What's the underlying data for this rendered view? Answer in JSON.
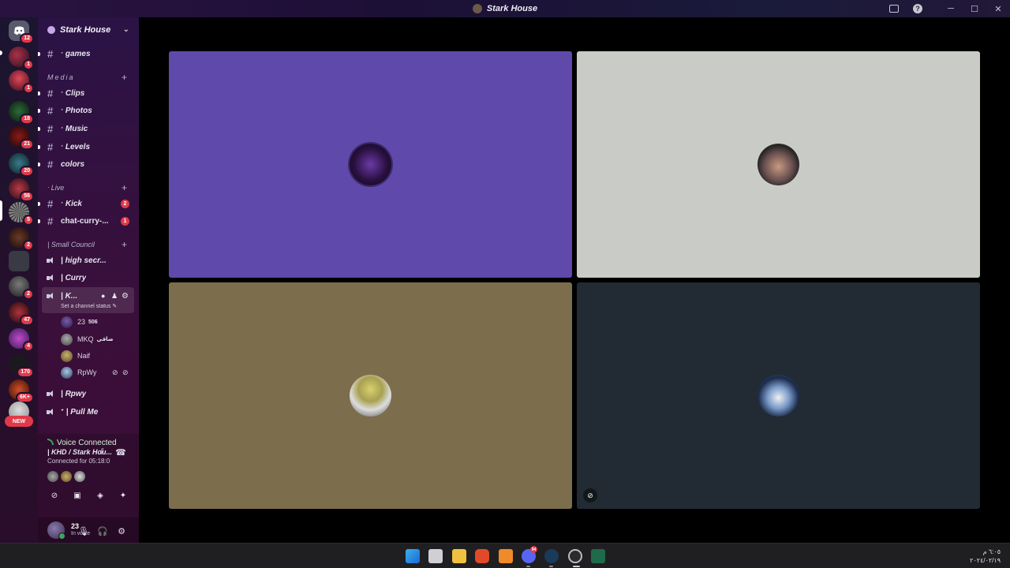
{
  "window": {
    "title": "Stark House"
  },
  "server_badges": [
    "12",
    "1",
    "1",
    "18",
    "21",
    "20",
    "56",
    "5",
    "2",
    "2",
    "47",
    "4",
    "170",
    "6K+"
  ],
  "server_new_label": "NEW",
  "guild": {
    "name": "Stark House"
  },
  "channels": {
    "games": "ᐧ games",
    "media_category": "Media",
    "clips": "ᐧ Clips",
    "photos": "ᐧ Photos",
    "music": "ᐧ Music",
    "levels": "ᐧ Levels",
    "colors": "colors",
    "live_category": "ᐧ Live",
    "kick": "ᐧ Kick",
    "kick_count": "2",
    "chat": "chat-curry-...",
    "chat_count": "1",
    "council_category": "| Small Council",
    "high_secret": "| high secr...",
    "curry": "| Curry",
    "khd": "| K...",
    "khd_status": "Set a channel status",
    "rpwy": "| Rpwy",
    "pull_me": "ᐩ | Pull Me"
  },
  "voice_users": [
    {
      "name": "23",
      "extra": "506"
    },
    {
      "name": "MKQ",
      "extra": "ضاقي"
    },
    {
      "name": "Naif",
      "extra": ""
    },
    {
      "name": "RpWy",
      "extra": ""
    }
  ],
  "voice_panel": {
    "title": "Voice Connected",
    "channel": "| KHD / Stark Hou...",
    "connected_for": "Connected for 05:18:0"
  },
  "user": {
    "name": "23",
    "status": "In voice"
  },
  "taskbar": {
    "discord_badge": "94",
    "time": "٦:٠٥ م",
    "date": "٢٠٢٤/٠٢/١٩"
  },
  "colors": {
    "tile_purple": "#5f4aab",
    "tile_gray": "#c8cbc6",
    "tile_olive": "#7c6d4c",
    "tile_dark": "#222a33",
    "badge_red": "#e03a4a",
    "online_green": "#3ba55c"
  },
  "icons": [
    "discord-icon",
    "hash-icon",
    "speaker-icon",
    "chat-bubble-icon",
    "add-member-icon",
    "gear-icon",
    "camera-off-icon",
    "screen-share-icon",
    "activity-icon",
    "soundboard-icon",
    "disconnect-icon",
    "noise-suppression-icon",
    "microphone-icon",
    "headphones-icon",
    "inbox-icon",
    "help-icon"
  ]
}
